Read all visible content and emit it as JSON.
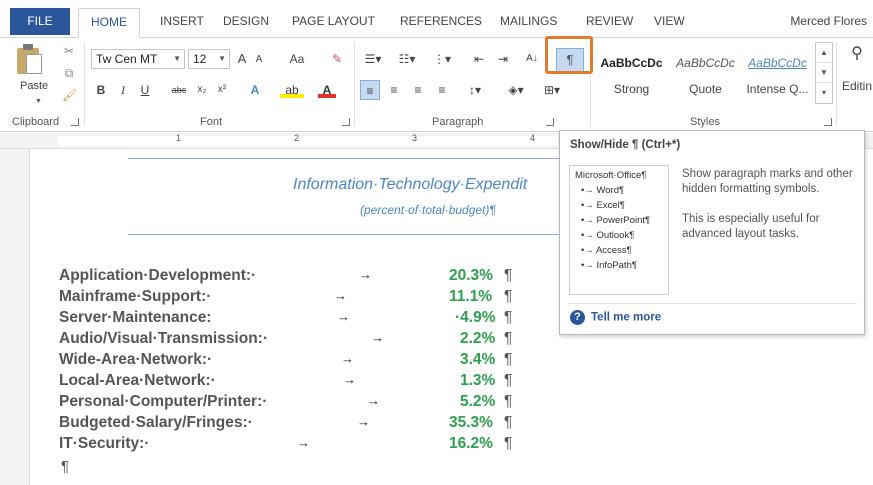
{
  "tabs": {
    "file": "FILE",
    "home": "HOME",
    "insert": "INSERT",
    "design": "DESIGN",
    "page_layout": "PAGE LAYOUT",
    "references": "REFERENCES",
    "mailings": "MAILINGS",
    "review": "REVIEW",
    "view": "VIEW"
  },
  "user_name": "Merced Flores",
  "ribbon": {
    "clipboard": {
      "paste_label": "Paste",
      "group_label": "Clipboard"
    },
    "font": {
      "font_name": "Tw Cen MT",
      "font_size": "12",
      "group_label": "Font",
      "grow": "A",
      "shrink": "A",
      "change_case": "Aa",
      "bold": "B",
      "italic": "I",
      "underline": "U",
      "strike": "abc",
      "subscript": "x₂",
      "superscript": "x²"
    },
    "paragraph": {
      "group_label": "Paragraph",
      "show_hide": "¶"
    },
    "styles": {
      "group_label": "Styles",
      "items": [
        {
          "sample": "AaBbCcDc",
          "name": "Strong"
        },
        {
          "sample": "AaBbCcDc",
          "name": "Quote"
        },
        {
          "sample": "AaBbCcDc",
          "name": "Intense Q..."
        }
      ]
    },
    "editing": {
      "label": "Editin"
    }
  },
  "ruler_numbers": [
    "1",
    "2",
    "3",
    "4"
  ],
  "document": {
    "title": "Information·Technology·Expendit",
    "subtitle": "(percent·of·total·budget)¶",
    "rows": [
      {
        "label": "Application·Development:·",
        "value": "20.3%"
      },
      {
        "label": "Mainframe·Support:·",
        "value": "11.1%"
      },
      {
        "label": "Server·Maintenance:",
        "value": "·4.9%"
      },
      {
        "label": "Audio/Visual·Transmission:·",
        "value": "2.2%"
      },
      {
        "label": "Wide-Area·Network:·",
        "value": "3.4%"
      },
      {
        "label": "Local-Area·Network:·",
        "value": "1.3%"
      },
      {
        "label": "Personal·Computer/Printer:·",
        "value": "5.2%"
      },
      {
        "label": "Budgeted·Salary/Fringes:·",
        "value": "35.3%"
      },
      {
        "label": "IT·Security:·",
        "value": "16.2%"
      }
    ],
    "pilcrow": "¶",
    "tab_arrow": "→"
  },
  "tooltip": {
    "title": "Show/Hide ¶ (Ctrl+*)",
    "preview_title": "Microsoft·Office¶",
    "preview_items": [
      "•→ Word¶",
      "•→ Excel¶",
      "•→ PowerPoint¶",
      "•→ Outlook¶",
      "•→ Access¶",
      "•→ InfoPath¶"
    ],
    "description_1": "Show paragraph marks and other hidden formatting symbols.",
    "description_2": "This is especially useful for advanced layout tasks.",
    "tell_me_more": "Tell me more"
  },
  "colors": {
    "accent": "#2b579a",
    "highlight_border": "#e07b2c",
    "value_green": "#2ea04e",
    "title_blue": "#4a87c8"
  }
}
